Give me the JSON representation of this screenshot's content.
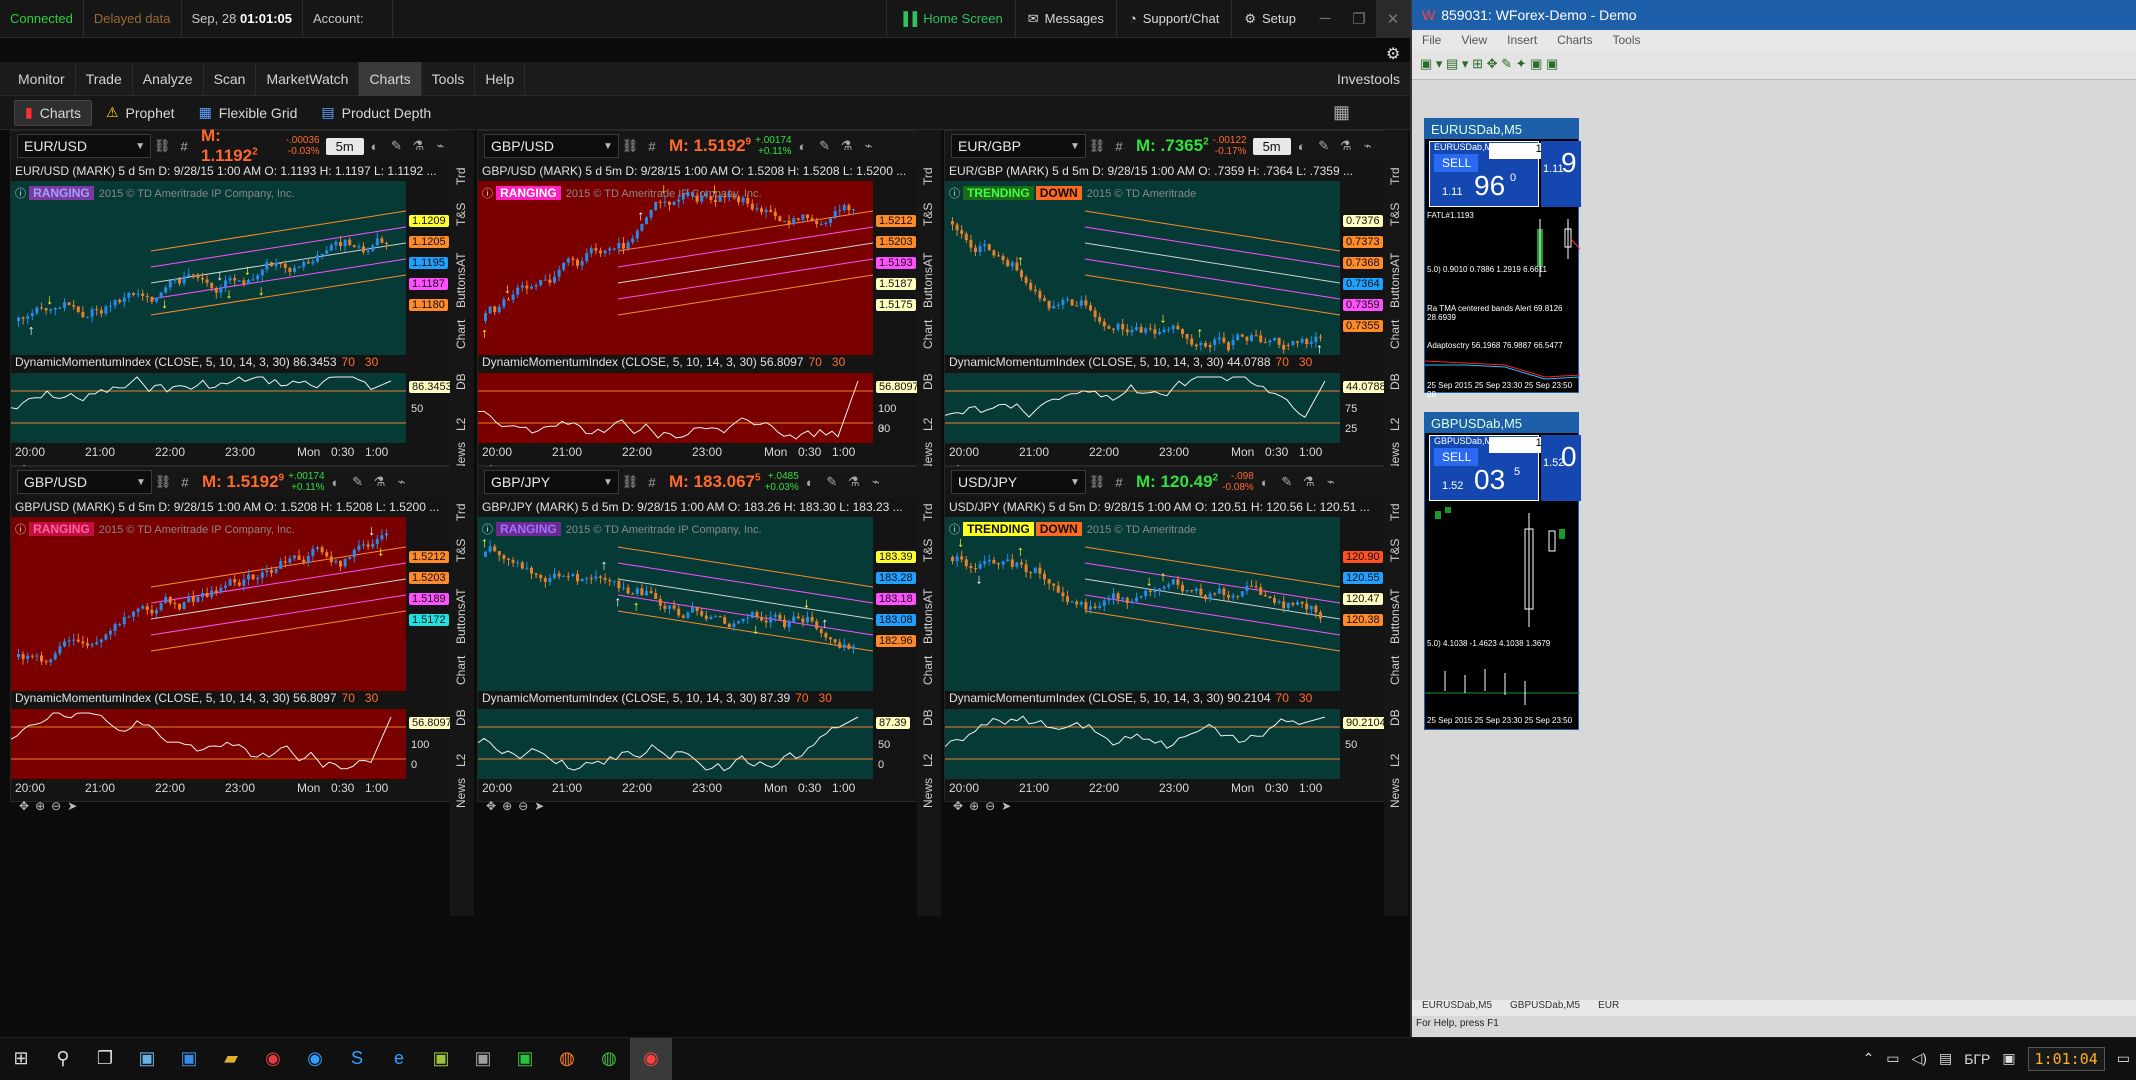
{
  "topbar": {
    "status": "Connected",
    "delayed": "Delayed data",
    "date": "Sep, 28",
    "time": "01:01:05",
    "account": "Account:",
    "home": "Home Screen",
    "messages": "Messages",
    "support": "Support/Chat",
    "setup": "Setup"
  },
  "menu": [
    "Monitor",
    "Trade",
    "Analyze",
    "Scan",
    "MarketWatch",
    "Charts",
    "Tools",
    "Help"
  ],
  "menu_active": "Charts",
  "investools": "Investools",
  "subtabs": [
    "Charts",
    "Prophet",
    "Flexible Grid",
    "Product Depth"
  ],
  "side_tabs": [
    "Trd",
    "T&S",
    "AT",
    "Buttons",
    "Chart",
    "DB",
    "L2",
    "News"
  ],
  "panels": [
    {
      "symbol": "EUR/USD",
      "mark": "M: 1.1192",
      "mark_sup": "2",
      "mark_color": "#ff6a2a",
      "chg1": "-.00036",
      "chg2": "-0.03%",
      "chg_color": "#ff6a2a",
      "tf": "5m",
      "info": "EUR/USD (MARK) 5 d 5m  D: 9/28/15 1:00 AM  O: 1.1193  H: 1.1197  L: 1.1192  ...",
      "state": "RANGING",
      "state_color": "#7a3aa0",
      "state_text_color": "#a0a0ff",
      "dir": "",
      "copyright": "2015 © TD Ameritrade IP Company, Inc.",
      "bg": "#063a36",
      "sub": "DynamicMomentumIndex (CLOSE, 5, 10, 14, 3, 30)",
      "subval": "86.3453",
      "lv1": "70",
      "lv2": "30",
      "prices": [
        {
          "v": "1.1209",
          "c": "#ffff30"
        },
        {
          "v": "1.1205",
          "c": "#ff8a2a"
        },
        {
          "v": "1.1195",
          "c": "#20a0ff"
        },
        {
          "v": "1.1187",
          "c": "#ff50ff"
        },
        {
          "v": "1.1180",
          "c": "#ff8a2a"
        }
      ],
      "dmi_label": "86.3453",
      "dmi_ticks": [
        "50"
      ]
    },
    {
      "symbol": "GBP/USD",
      "mark": "M: 1.5192",
      "mark_sup": "9",
      "mark_color": "#ff6a2a",
      "chg1": "+.00174",
      "chg2": "+0.11%",
      "chg_color": "#30e040",
      "tf": "",
      "info": "GBP/USD (MARK) 5 d 5m  D: 9/28/15 1:00 AM  O: 1.5208  H: 1.5208  L: 1.5200  ...",
      "state": "RANGING",
      "state_color": "#ff20c0",
      "state_text_color": "#ffffff",
      "dir": "",
      "copyright": "2015 © TD Ameritrade IP Company, Inc.",
      "bg": "#7a0000",
      "sub": "DynamicMomentumIndex (CLOSE, 5, 10, 14, 3, 30)",
      "subval": "56.8097",
      "lv1": "70",
      "lv2": "30",
      "prices": [
        {
          "v": "1.5212",
          "c": "#ff8a2a"
        },
        {
          "v": "1.5203",
          "c": "#ff8a2a"
        },
        {
          "v": "1.5193",
          "c": "#ff50ff"
        },
        {
          "v": "1.5187",
          "c": "#ffffc0"
        },
        {
          "v": "1.5175",
          "c": "#ffffc0"
        }
      ],
      "dmi_label": "56.8097",
      "dmi_ticks": [
        "100",
        "30",
        "0"
      ]
    },
    {
      "symbol": "EUR/GBP",
      "mark": "M: .7365",
      "mark_sup": "2",
      "mark_color": "#30e040",
      "chg1": "-.00122",
      "chg2": "-0.17%",
      "chg_color": "#ff6a2a",
      "tf": "5m",
      "info": "EUR/GBP (MARK) 5 d 5m  D: 9/28/15 1:00 AM  O: .7359  H: .7364  L: .7359  ...",
      "state": "TRENDING",
      "state_color": "#1a6a1a",
      "state_text_color": "#40ff40",
      "dir": "DOWN",
      "copyright": "2015 © TD Ameritrade",
      "bg": "#063a36",
      "sub": "DynamicMomentumIndex (CLOSE, 5, 10, 14, 3, 30)",
      "subval": "44.0788",
      "lv1": "70",
      "lv2": "30",
      "prices": [
        {
          "v": "0.7376",
          "c": "#ffffc0"
        },
        {
          "v": "0.7373",
          "c": "#ff8a2a"
        },
        {
          "v": "0.7368",
          "c": "#ff8a2a"
        },
        {
          "v": "0.7364",
          "c": "#20a0ff"
        },
        {
          "v": "0.7359",
          "c": "#ff50ff"
        },
        {
          "v": "0.7355",
          "c": "#ff8a2a"
        }
      ],
      "dmi_label": "44.0788",
      "dmi_ticks": [
        "75",
        "25"
      ]
    },
    {
      "symbol": "GBP/USD",
      "mark": "M: 1.5192",
      "mark_sup": "9",
      "mark_color": "#ff6a2a",
      "chg1": "+.00174",
      "chg2": "+0.11%",
      "chg_color": "#30e040",
      "tf": "",
      "info": "GBP/USD (MARK) 5 d 5m  D: 9/28/15 1:00 AM  O: 1.5208  H: 1.5208  L: 1.5200  ...",
      "state": "RANGING",
      "state_color": "#c01040",
      "state_text_color": "#ff60a0",
      "dir": "",
      "copyright": "2015 © TD Ameritrade IP Company, Inc.",
      "bg": "#7a0000",
      "sub": "DynamicMomentumIndex (CLOSE, 5, 10, 14, 3, 30)",
      "subval": "56.8097",
      "lv1": "70",
      "lv2": "30",
      "prices": [
        {
          "v": "1.5212",
          "c": "#ff8a2a"
        },
        {
          "v": "1.5203",
          "c": "#ff8a2a"
        },
        {
          "v": "1.5189",
          "c": "#ff50ff"
        },
        {
          "v": "1.5172",
          "c": "#20e0e0"
        }
      ],
      "dmi_label": "56.8097",
      "dmi_ticks": [
        "100",
        "0"
      ]
    },
    {
      "symbol": "GBP/JPY",
      "mark": "M: 183.067",
      "mark_sup": "5",
      "mark_color": "#ff6a2a",
      "chg1": "+.0485",
      "chg2": "+0.03%",
      "chg_color": "#30e040",
      "tf": "",
      "info": "GBP/JPY (MARK) 5 d 5m  D: 9/28/15 1:00 AM  O: 183.26  H: 183.30  L: 183.23  ...",
      "state": "RANGING",
      "state_color": "#6a2a90",
      "state_text_color": "#a070ff",
      "dir": "",
      "copyright": "2015 © TD Ameritrade IP Company, Inc.",
      "bg": "#063a36",
      "sub": "DynamicMomentumIndex (CLOSE, 5, 10, 14, 3, 30)",
      "subval": "87.39",
      "lv1": "70",
      "lv2": "30",
      "prices": [
        {
          "v": "183.39",
          "c": "#ffff30"
        },
        {
          "v": "183.28",
          "c": "#20a0ff"
        },
        {
          "v": "183.18",
          "c": "#ff50ff"
        },
        {
          "v": "183.08",
          "c": "#20a0ff"
        },
        {
          "v": "182.96",
          "c": "#ff8a2a"
        }
      ],
      "dmi_label": "87.39",
      "dmi_ticks": [
        "50",
        "0"
      ]
    },
    {
      "symbol": "USD/JPY",
      "mark": "M: 120.49",
      "mark_sup": "2",
      "mark_color": "#30e040",
      "chg1": "-.098",
      "chg2": "-0.08%",
      "chg_color": "#ff6a2a",
      "tf": "",
      "info": "USD/JPY (MARK) 5 d 5m  D: 9/28/15 1:00 AM  O: 120.51  H: 120.56  L: 120.51  ...",
      "state": "TRENDING",
      "state_color": "#ffff20",
      "state_text_color": "#111111",
      "dir": "DOWN",
      "copyright": "2015 © TD Ameritrade",
      "bg": "#063a36",
      "sub": "DynamicMomentumIndex (CLOSE, 5, 10, 14, 3, 30)",
      "subval": "90.2104",
      "lv1": "70",
      "lv2": "30",
      "prices": [
        {
          "v": "120.90",
          "c": "#ff5020"
        },
        {
          "v": "120.55",
          "c": "#20a0ff"
        },
        {
          "v": "120.47",
          "c": "#ffffc0"
        },
        {
          "v": "120.38",
          "c": "#ff8a2a"
        }
      ],
      "dmi_label": "90.2104",
      "dmi_ticks": [
        "50"
      ]
    }
  ],
  "xaxis": [
    "20:00",
    "21:00",
    "22:00",
    "23:00",
    "Mon",
    "0:30",
    "1:00"
  ],
  "mt4": {
    "title": "859031: WForex-Demo - Demo",
    "menu": [
      "File",
      "View",
      "Insert",
      "Charts",
      "Tools"
    ],
    "sub1": {
      "title": "EURUSDab,M5",
      "inner": "EURUSDab,M5",
      "sell": "SELL",
      "lot": "1.00",
      "big": "96",
      "bigsup": "0",
      "prefix": "1.11",
      "prefix2": "1.11",
      "rightbig": "9",
      "fatl": "FATL#1.1193",
      "ind1": "5.0) 0.9010 0.7886 1.2919 6.6611",
      "ind2": "Ra TMA centered bands Alert 69.8126 28.6939",
      "ind3": "Adaptosctry 56.1968 76.9887 66.5477",
      "dates": "25 Sep 2015   25 Sep 23:30   25 Sep 23:50   28"
    },
    "sub2": {
      "title": "GBPUSDab,M5",
      "inner": "GBPUSDab,M5",
      "sell": "SELL",
      "lot": "1.00",
      "big": "03",
      "bigsup": "5",
      "prefix": "1.52",
      "prefix2": "1.52",
      "rightbig": "0",
      "ind1": "5.0) 4.1038 -1.4623 4.1038 1.3679",
      "dates": "25 Sep 2015   25 Sep 23:30   25 Sep 23:50"
    },
    "tabs": [
      "EURUSDab,M5",
      "GBPUSDab,M5",
      "EUR"
    ],
    "status": "For Help, press F1"
  },
  "taskbar": {
    "lang": "БГР",
    "clock": "1:01:04"
  }
}
